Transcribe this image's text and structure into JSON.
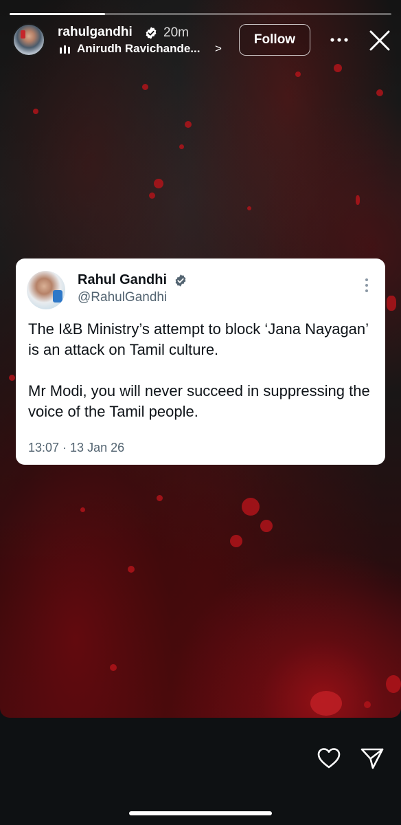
{
  "story": {
    "progress": 0.25,
    "username": "rahulgandhi",
    "timestamp": "20m",
    "music": "Anirudh Ravichande...",
    "music_chevron": ">",
    "follow_label": "Follow"
  },
  "tweet": {
    "name": "Rahul Gandhi",
    "handle": "@RahulGandhi",
    "paragraph_1": "The I&B Ministry’s attempt to block ‘Jana Nayagan’ is an attack on Tamil culture.",
    "paragraph_2": "Mr Modi, you will never succeed in suppressing the voice of the Tamil people.",
    "time": "13:07 · 13 Jan 26"
  },
  "colors": {
    "verified": "#1d9bf0",
    "accent_red": "#c6262b",
    "background": "#0e1113"
  },
  "icons": [
    "verified-badge-icon",
    "music-bars-icon",
    "more-icon",
    "close-icon",
    "heart-icon",
    "send-icon"
  ]
}
